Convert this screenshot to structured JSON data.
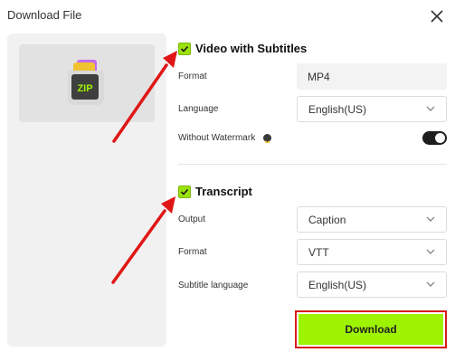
{
  "dialog": {
    "title": "Download File"
  },
  "video": {
    "title": "Video with Subtitles",
    "format_label": "Format",
    "format_value": "MP4",
    "language_label": "Language",
    "language_value": "English(US)",
    "watermark_label": "Without Watermark",
    "watermark_on": true
  },
  "transcript": {
    "title": "Transcript",
    "output_label": "Output",
    "output_value": "Caption",
    "format_label": "Format",
    "format_value": "VTT",
    "subtitle_language_label": "Subtitle language",
    "subtitle_language_value": "English(US)"
  },
  "actions": {
    "download_label": "Download"
  },
  "colors": {
    "accent": "#9ef300",
    "checkbox": "#9be10c",
    "annotation": "#e01616"
  },
  "icons": {
    "close": "close-icon",
    "zip": "zip-file-icon",
    "crown": "crown-icon",
    "chevron": "chevron-down-icon"
  },
  "preview": {
    "badge_text": "ZIP"
  }
}
